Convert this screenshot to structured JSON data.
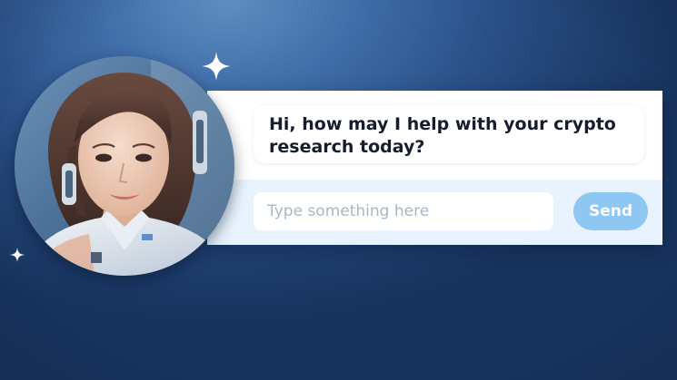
{
  "chat": {
    "avatar_icon": "assistant-avatar",
    "message": "Hi, how may I help with your crypto research today?",
    "input": {
      "value": "",
      "placeholder": "Type something here"
    },
    "send_label": "Send"
  },
  "decorations": {
    "sparkle_icon": "sparkle-icon"
  },
  "colors": {
    "background": "#2b5189",
    "panel": "#ffffff",
    "input_area": "#e8f3fd",
    "send_button": "#8ec7f2",
    "message_text": "#161d2c",
    "placeholder": "#a9b6c5"
  }
}
